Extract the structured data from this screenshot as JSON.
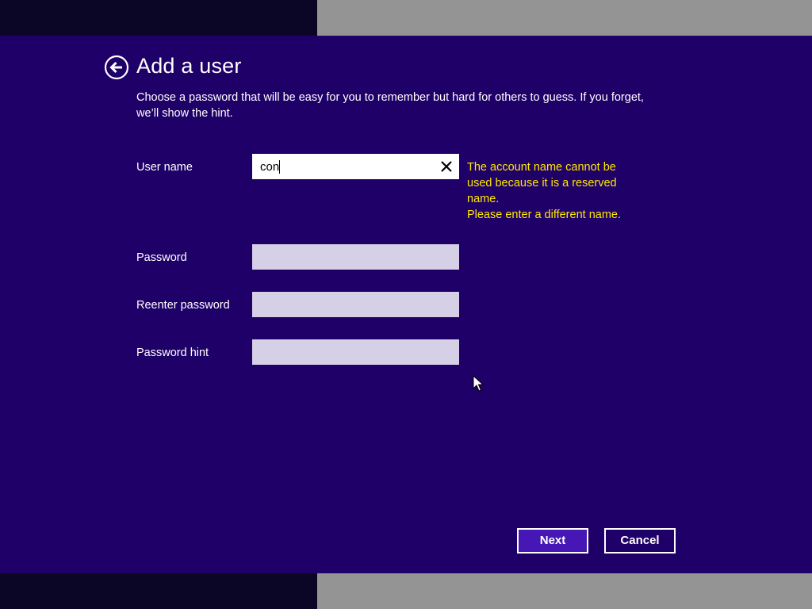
{
  "header": {
    "title": "Add a user",
    "back_icon": "back-arrow-circle-icon"
  },
  "instructions": "Choose a password that will be easy for you to remember but hard for others to guess. If you forget, we’ll show the hint.",
  "form": {
    "username": {
      "label": "User name",
      "value": "con",
      "clear_icon": "close-icon"
    },
    "password": {
      "label": "Password",
      "value": ""
    },
    "reenter_password": {
      "label": "Reenter password",
      "value": ""
    },
    "password_hint": {
      "label": "Password hint",
      "value": ""
    },
    "error": {
      "lines": [
        "The account name cannot be",
        "used because it is a reserved",
        "name.",
        "Please enter a different name."
      ]
    }
  },
  "buttons": {
    "next_label": "Next",
    "cancel_label": "Cancel"
  },
  "colors": {
    "background": "#1f0068",
    "accent_button": "#4617b4",
    "error_text": "#ffe800",
    "input_disabled": "#d6d0e6"
  }
}
